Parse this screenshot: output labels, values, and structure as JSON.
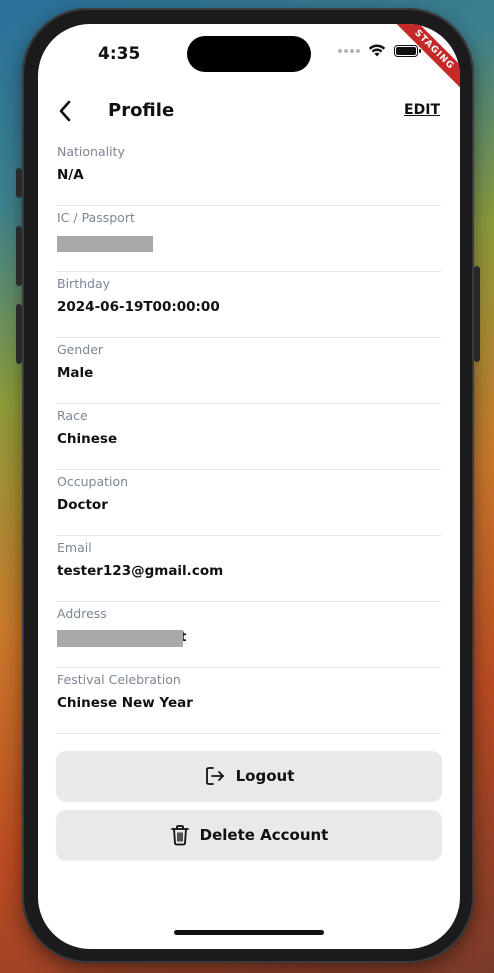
{
  "status_bar": {
    "time": "4:35",
    "ribbon": "STAGING"
  },
  "header": {
    "title": "Profile",
    "edit_label": "EDIT"
  },
  "fields": [
    {
      "label": "Nationality",
      "value": "N/A"
    },
    {
      "label": "IC / Passport",
      "value": ""
    },
    {
      "label": "Birthday",
      "value": "2024-06-19T00:00:00"
    },
    {
      "label": "Gender",
      "value": "Male"
    },
    {
      "label": "Race",
      "value": "Chinese"
    },
    {
      "label": "Occupation",
      "value": "Doctor"
    },
    {
      "label": "Email",
      "value": "tester123@gmail.com"
    },
    {
      "label": "Address",
      "value": "t"
    },
    {
      "label": "Festival Celebration",
      "value": "Chinese New Year"
    }
  ],
  "actions": {
    "logout_label": "Logout",
    "delete_label": "Delete Account"
  },
  "icons": [
    "back-chevron-icon",
    "logout-icon",
    "trash-icon",
    "wifi-icon",
    "battery-icon"
  ]
}
